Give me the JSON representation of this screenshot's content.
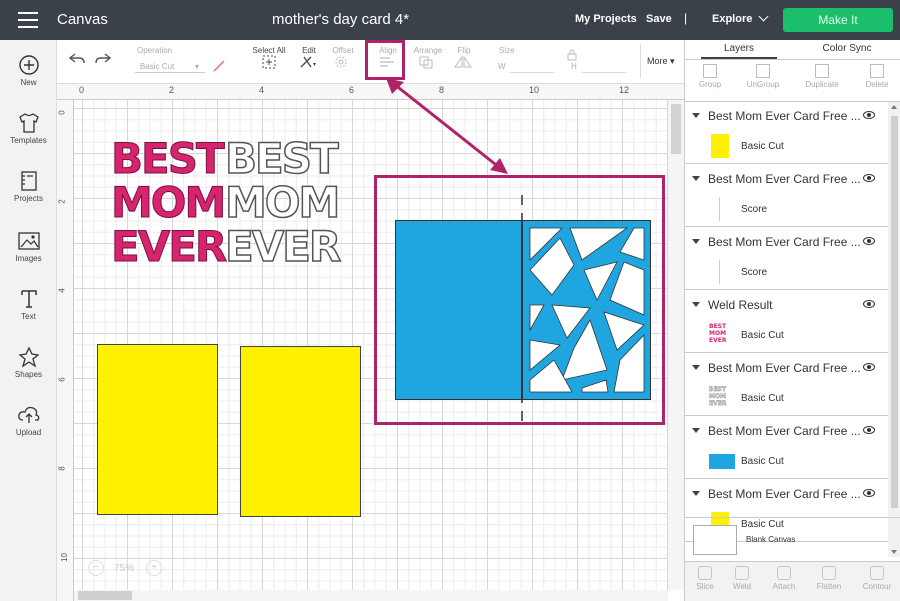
{
  "app": {
    "title": "Canvas",
    "project_title": "mother's day card 4*"
  },
  "header": {
    "my_projects": "My Projects",
    "save": "Save",
    "separator": "|",
    "explore": "Explore",
    "make_it": "Make It"
  },
  "sidebar": {
    "items": [
      {
        "label": "New",
        "icon": "plus-circle-icon"
      },
      {
        "label": "Templates",
        "icon": "shirt-icon"
      },
      {
        "label": "Projects",
        "icon": "projects-icon"
      },
      {
        "label": "Images",
        "icon": "image-icon"
      },
      {
        "label": "Text",
        "icon": "text-icon"
      },
      {
        "label": "Shapes",
        "icon": "shapes-icon"
      },
      {
        "label": "Upload",
        "icon": "upload-icon"
      }
    ]
  },
  "toolbar": {
    "operation_label": "Operation",
    "operation_value": "Basic Cut",
    "select_all": "Select All",
    "edit": "Edit",
    "offset": "Offset",
    "align": "Align",
    "arrange": "Arrange",
    "flip": "Flip",
    "size": "Size",
    "w_label": "W",
    "h_label": "H",
    "more": "More"
  },
  "ruler": {
    "top": [
      "0",
      "2",
      "4",
      "6",
      "8",
      "10",
      "12"
    ],
    "left": [
      "0",
      "2",
      "4",
      "6",
      "8",
      "10"
    ]
  },
  "canvas": {
    "text_design": [
      "BEST",
      "MOM",
      "EVER"
    ],
    "zoom": "75%"
  },
  "panel": {
    "tabs": [
      "Layers",
      "Color Sync"
    ],
    "tools": [
      "Group",
      "UnGroup",
      "Duplicate",
      "Delete"
    ],
    "layers": [
      {
        "name": "Best Mom Ever Card Free ...",
        "sub": "Basic Cut",
        "thumb": "yellow"
      },
      {
        "name": "Best Mom Ever Card Free ...",
        "sub": "Score",
        "thumb": "none"
      },
      {
        "name": "Best Mom Ever Card Free ...",
        "sub": "Score",
        "thumb": "none"
      },
      {
        "name": "Weld Result",
        "sub": "Basic Cut",
        "thumb": "text-pink"
      },
      {
        "name": "Best Mom Ever Card Free ...",
        "sub": "Basic Cut",
        "thumb": "text-white"
      },
      {
        "name": "Best Mom Ever Card Free ...",
        "sub": "Basic Cut",
        "thumb": "blue"
      },
      {
        "name": "Best Mom Ever Card Free ...",
        "sub": "Basic Cut",
        "thumb": "yellow"
      }
    ],
    "blank_canvas": "Blank Canvas",
    "footer": [
      "Slice",
      "Weld",
      "Attach",
      "Flatten",
      "Contour"
    ]
  },
  "colors": {
    "topbar": "#3b4149",
    "make_it": "#1bbf6b",
    "highlight": "#b0236a",
    "yellow": "#fff200",
    "blue": "#1fa6e0",
    "pink": "#d6246e"
  }
}
